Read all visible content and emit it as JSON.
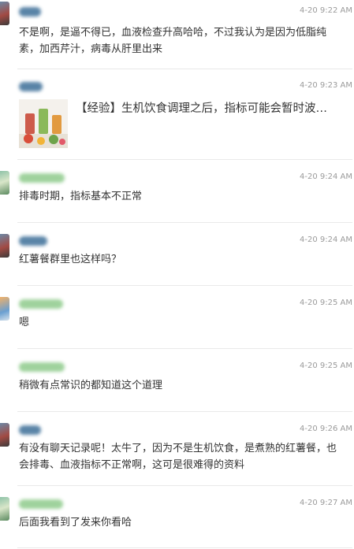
{
  "messages": [
    {
      "time": "4-20 9:22 AM",
      "text": "不是啊，是逼不得已，血液检查升高哈哈，不过我认为是因为低脂纯素，加西芹汁，病毒从肝里出来"
    },
    {
      "time": "4-20 9:23 AM",
      "link_title": "【经验】生机饮食调理之后，指标可能会暂时波…",
      "thumb_icon": "juice-glasses-image"
    },
    {
      "time": "4-20 9:24 AM",
      "text": "排毒时期，指标基本不正常"
    },
    {
      "time": "4-20 9:24 AM",
      "text": "红薯餐群里也这样吗？"
    },
    {
      "time": "4-20 9:25 AM",
      "text": "嗯"
    },
    {
      "time": "4-20 9:25 AM",
      "text": "稍微有点常识的都知道这个道理"
    },
    {
      "time": "4-20 9:26 AM",
      "text": "有没有聊天记录呢！太牛了，因为不是生机饮食，是煮熟的红薯餐，也会排毒、血液指标不正常啊，这可是很难得的资料"
    },
    {
      "time": "4-20 9:27 AM",
      "text": "后面我看到了发来你看哈"
    }
  ]
}
